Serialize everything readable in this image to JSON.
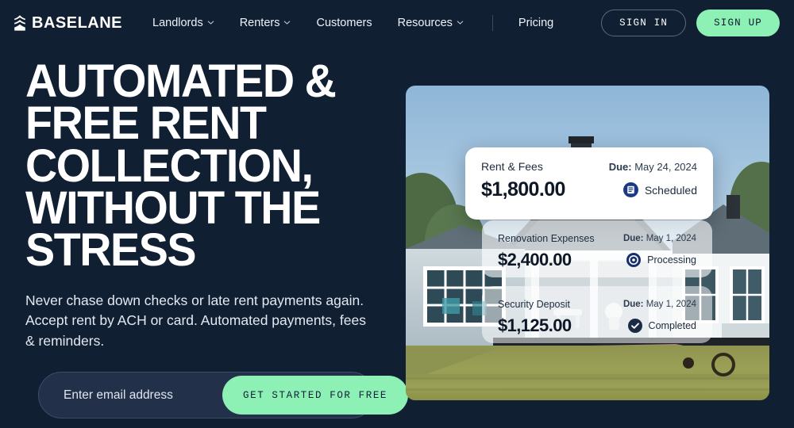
{
  "brand": {
    "name": "BASELANE",
    "logo_icon": "baselane-stack-icon"
  },
  "nav": {
    "items": [
      {
        "label": "Landlords",
        "has_dropdown": true,
        "icon": "chevron-down-icon"
      },
      {
        "label": "Renters",
        "has_dropdown": true,
        "icon": "chevron-down-icon"
      },
      {
        "label": "Customers",
        "has_dropdown": false
      },
      {
        "label": "Resources",
        "has_dropdown": true,
        "icon": "chevron-down-icon"
      },
      {
        "label": "Pricing",
        "has_dropdown": false
      }
    ],
    "sign_in_label": "SIGN IN",
    "sign_up_label": "SIGN UP"
  },
  "hero": {
    "headline_lines": [
      "AUTOMATED &",
      "FREE RENT",
      "COLLECTION,",
      "WITHOUT THE",
      "STRESS"
    ],
    "headline": "AUTOMATED & FREE RENT COLLECTION, WITHOUT THE STRESS",
    "subtext": "Never chase down checks or late rent payments again. Accept rent by ACH or card. Automated payments, fees & reminders.",
    "email_placeholder": "Enter email address",
    "email_value": "",
    "cta_label": "GET STARTED FOR FREE"
  },
  "media": {
    "alt": "suburban house with wooden deck and green lawn",
    "cards": [
      {
        "title": "Rent & Fees",
        "due_label": "Due:",
        "due_date": "May 24, 2024",
        "amount": "$1,800.00",
        "status": "Scheduled",
        "status_icon": "scheduled-list-icon"
      },
      {
        "title": "Renovation Expenses",
        "due_label": "Due:",
        "due_date": "May 1, 2024",
        "amount": "$2,400.00",
        "status": "Processing",
        "status_icon": "processing-ring-icon"
      },
      {
        "title": "Security Deposit",
        "due_label": "Due:",
        "due_date": "May 1, 2024",
        "amount": "$1,125.00",
        "status": "Completed",
        "status_icon": "check-circle-icon"
      }
    ]
  },
  "colors": {
    "background": "#111f33",
    "accent_green": "#8df0b4",
    "accent_navy": "#1b3a6b",
    "text_light": "#ffffff",
    "input_bg": "#22304a"
  }
}
